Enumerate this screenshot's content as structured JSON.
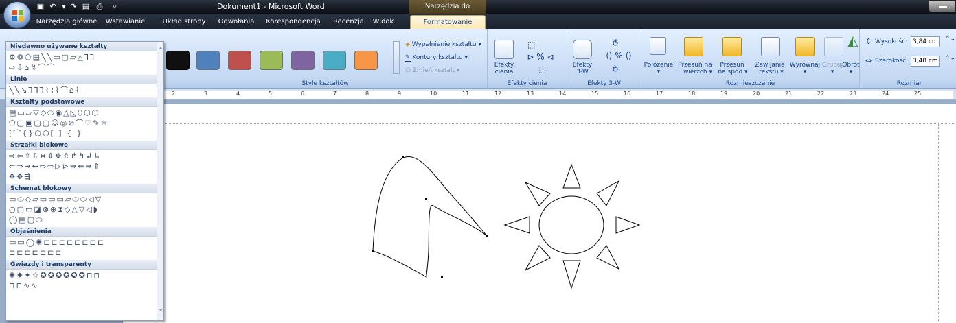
{
  "window": {
    "title": "Dokument1 - Microsoft Word",
    "context_title": "Narzędzia do rysowania"
  },
  "tabs": [
    {
      "label": "Narzędzia główne"
    },
    {
      "label": "Wstawianie"
    },
    {
      "label": "Układ strony"
    },
    {
      "label": "Odwołania"
    },
    {
      "label": "Korespondencja"
    },
    {
      "label": "Recenzja"
    },
    {
      "label": "Widok"
    },
    {
      "label": "Formatowanie",
      "active": true
    }
  ],
  "ribbon": {
    "shape_styles": {
      "label": "Style kształtów",
      "swatch_colors": [
        "#101010",
        "#4f81bd",
        "#c0504d",
        "#9bbb59",
        "#8064a2",
        "#4bacc6",
        "#f79646"
      ],
      "fill": "Wypełnienie kształtu",
      "outline": "Kontury kształtu",
      "change": "Zmień kształt"
    },
    "shadow": {
      "label": "Efekty cienia",
      "button": "Efekty cienia"
    },
    "effects3d": {
      "label": "Efekty 3-W",
      "button": "Efekty 3-W"
    },
    "arrange": {
      "label": "Rozmieszczanie",
      "position": "Położenie",
      "bring_front_1": "Przesuń na",
      "bring_front_2": "wierzch",
      "send_back_1": "Przesuń",
      "send_back_2": "na spód",
      "wrap_1": "Zawijanie",
      "wrap_2": "tekstu",
      "align": "Wyrównaj",
      "group": "Grupuj",
      "rotate": "Obrót"
    },
    "size": {
      "label": "Rozmiar",
      "height_label": "Wysokość:",
      "height_value": "3,84 cm",
      "width_label": "Szerokość:",
      "width_value": "3,48 cm"
    }
  },
  "ruler": {
    "marks": [
      "2",
      "3",
      "4",
      "5",
      "6",
      "7",
      "8",
      "9",
      "10",
      "11",
      "12",
      "13",
      "14",
      "15",
      "16",
      "17",
      "18",
      "19",
      "20",
      "21",
      "22",
      "23",
      "24",
      "25"
    ]
  },
  "gallery": {
    "categories": [
      {
        "title": "Niedawno używane kształty",
        "rows": [
          "⚙❁⬠▤╲╲▭▢▱△⅂⅂",
          "⇨⇩⌂↯⌒⌒"
        ]
      },
      {
        "title": "Linie",
        "rows": [
          "╲╲↘⅂⅂⅂⌇⌇⌇⌒⌂⌇"
        ]
      },
      {
        "title": "Kształty podstawowe",
        "rows": [
          "▤▭▱▽◇⬭◉△◺⬯⬡⬡",
          "⬠▢▣▢▢☺◎⊘⌒♡✎☼",
          "⁅⌒{}⬡⬡[ ] { }"
        ]
      },
      {
        "title": "Strzałki blokowe",
        "rows": [
          "⇨⇦⇧⇩⇔⇕✥⇯↱↰↲↳",
          "⇐⇒⇝⇜⇨⇨▷⊳⇛⇚⇛⇑",
          "✥✥⇶"
        ]
      },
      {
        "title": "Schemat blokowy",
        "rows": [
          "▭⬭◇▱▭▭▭▱⬭⬭◁▽",
          "○▢▭◪⊗⊕⧗◇△▽◁◗",
          "◯▤▢⬭"
        ]
      },
      {
        "title": "Objaśnienia",
        "rows": [
          "▭▭◯✺⊏⊏⊏⊏⊏⊏⊏⊏",
          "⊏⊏⊏⊏⊏⊏⊏"
        ]
      },
      {
        "title": "Gwiazdy i transparenty",
        "rows": [
          "✺✹✦☆✪✪✪✪✪✪⊓⊓",
          "⊓⊓∿∿"
        ]
      }
    ]
  }
}
